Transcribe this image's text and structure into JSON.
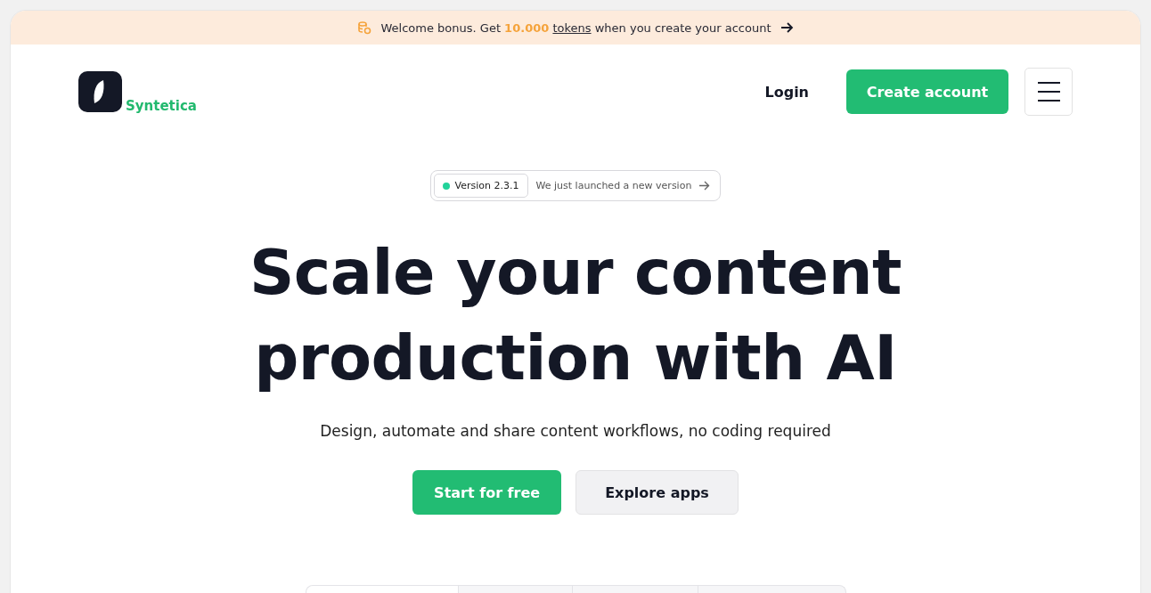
{
  "banner": {
    "prefix": "Welcome bonus. Get ",
    "highlight": "10.000",
    "link": "tokens",
    "suffix": " when you create your account"
  },
  "header": {
    "brand": "Syntetica",
    "login": "Login",
    "cta": "Create account"
  },
  "badge": {
    "version": "Version 2.3.1",
    "message": "We just launched a new version",
    "color": "#22d39a"
  },
  "hero": {
    "title_lines": [
      "Scale your content",
      "production with AI"
    ],
    "subtitle": "Design, automate and share content workflows, no coding required"
  },
  "buttons": [
    {
      "label": "Start for free",
      "kind": "primary"
    },
    {
      "label": "Explore apps",
      "kind": "secondary"
    }
  ]
}
